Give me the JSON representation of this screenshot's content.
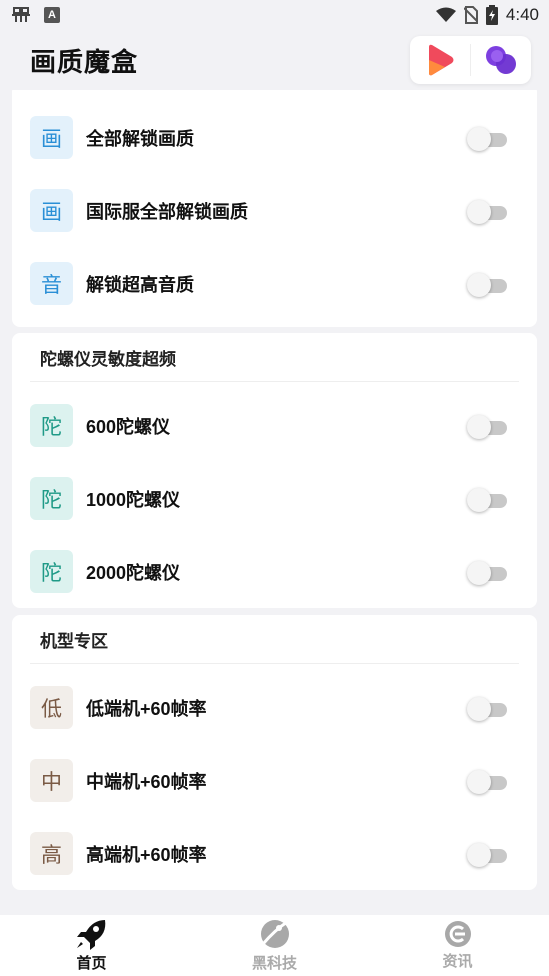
{
  "status": {
    "time": "4:40",
    "a_badge": "A"
  },
  "header": {
    "title": "画质魔盒"
  },
  "sections": [
    {
      "title": "",
      "rows": [
        {
          "tag": "画",
          "label": "全部解锁画质",
          "on": false
        },
        {
          "tag": "画",
          "label": "国际服全部解锁画质",
          "on": false
        },
        {
          "tag": "音",
          "label": "解锁超高音质",
          "on": false
        }
      ]
    },
    {
      "title": "陀螺仪灵敏度超频",
      "rows": [
        {
          "tag": "陀",
          "label": "600陀螺仪",
          "on": false
        },
        {
          "tag": "陀",
          "label": "1000陀螺仪",
          "on": false
        },
        {
          "tag": "陀",
          "label": "2000陀螺仪",
          "on": false
        }
      ]
    },
    {
      "title": "机型专区",
      "rows": [
        {
          "tag": "低",
          "label": "低端机+60帧率",
          "on": false
        },
        {
          "tag": "中",
          "label": "中端机+60帧率",
          "on": false
        },
        {
          "tag": "高",
          "label": "高端机+60帧率",
          "on": false
        }
      ]
    }
  ],
  "tabs": [
    {
      "label": "首页",
      "icon": "rocket-icon",
      "active": true
    },
    {
      "label": "黑科技",
      "icon": "planet-icon",
      "active": false
    },
    {
      "label": "资讯",
      "icon": "news-icon",
      "active": false
    }
  ],
  "colors": {
    "blue": "#2a8fd6",
    "teal": "#1f9a87",
    "brown": "#7a5a45"
  }
}
